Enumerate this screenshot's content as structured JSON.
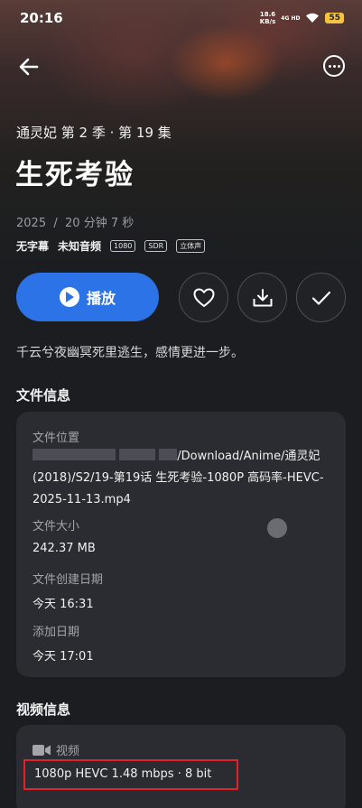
{
  "status": {
    "time": "20:16",
    "net_speed": "18.6",
    "net_unit": "KB/s",
    "network": "4G HD",
    "battery": "55"
  },
  "episode": {
    "series_line": "通灵妃 第 2 季 · 第 19 集",
    "title": "生死考验",
    "year": "2025",
    "duration": "20 分钟 7 秒",
    "subtitle_tag": "无字幕",
    "audio_tag": "未知音频",
    "badges": [
      "1080",
      "SDR",
      "立体声"
    ],
    "description": "千云兮夜幽冥死里逃生，感情更进一步。"
  },
  "actions": {
    "play_label": "播放",
    "icons": [
      "heart-icon",
      "download-icon",
      "check-icon"
    ]
  },
  "file_info": {
    "section_title": "文件信息",
    "location_label": "文件位置",
    "location_value": "/Download/Anime/通灵妃 (2018)/S2/19-第19话 生死考验-1080P 高码率-HEVC-2025-11-13.mp4",
    "size_label": "文件大小",
    "size_value": "242.37 MB",
    "created_label": "文件创建日期",
    "created_value": "今天 16:31",
    "added_label": "添加日期",
    "added_value": "今天 17:01"
  },
  "video_info": {
    "section_title": "视频信息",
    "label": "视频",
    "value": "1080p HEVC 1.48 mbps · 8 bit"
  },
  "colors": {
    "accent": "#2d73e8",
    "background": "#1b1d21",
    "card": "#2a2c31",
    "highlight_box": "#e0222a"
  }
}
